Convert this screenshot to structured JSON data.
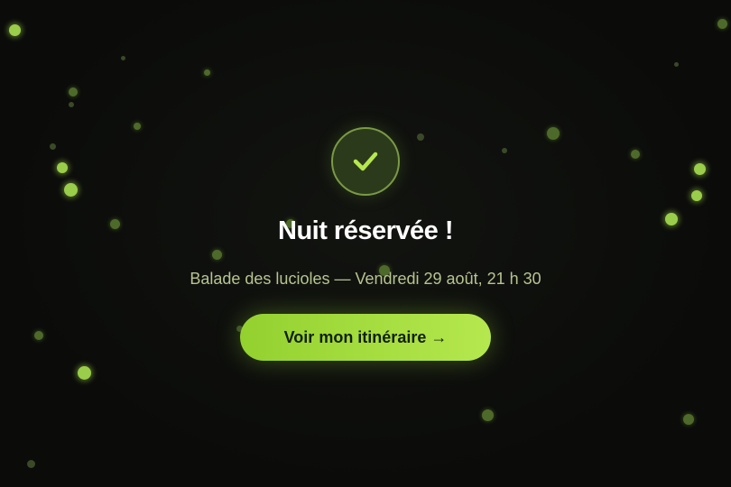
{
  "confirmation": {
    "title": "Nuit réservée !",
    "subtitle": "Balade des lucioles — Vendredi 29 août, 21 h 30",
    "cta_label": "Voir mon itinéraire →",
    "icon": "check-icon"
  },
  "colors": {
    "background": "#0b0c0a",
    "accent": "#a6dc3c",
    "check_stroke": "#b5e84e",
    "subtitle": "#b7c48f",
    "title": "#ffffff"
  }
}
